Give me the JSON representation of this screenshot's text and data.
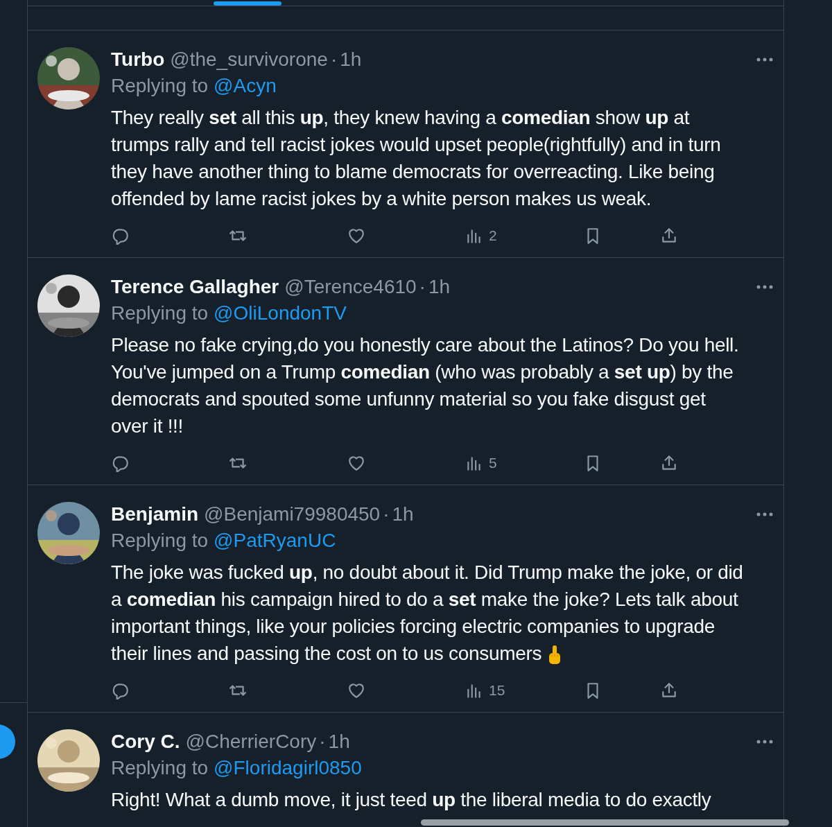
{
  "tweets": [
    {
      "name": "Turbo",
      "handle": "@the_survivorone",
      "separator": "·",
      "time": "1h",
      "replying_label": "Replying to",
      "replying_to": "@Acyn",
      "text": "They really **set** all this **up**, they knew having a **comedian** show **up** at trumps rally and tell racist jokes would upset people(rightfully) and in turn they have another thing to blame democrats for overreacting. Like being offended by lame racist jokes by a white person makes us weak.",
      "views": "2",
      "emoji": false
    },
    {
      "name": "Terence Gallagher",
      "handle": "@Terence4610",
      "separator": "·",
      "time": "1h",
      "replying_label": "Replying to",
      "replying_to": "@OliLondonTV",
      "text": "Please no fake crying,do you honestly care about the Latinos? Do you hell. You've jumped on a Trump **comedian** (who was probably a **set up**) by the democrats and spouted some unfunny material so you fake disgust get over it !!!",
      "views": "5",
      "emoji": false
    },
    {
      "name": "Benjamin",
      "handle": "@Benjami79980450",
      "separator": "·",
      "time": "1h",
      "replying_label": "Replying to",
      "replying_to": "@PatRyanUC",
      "text": "The joke was fucked **up**, no doubt about it. Did Trump make the joke, or did a **comedian** his campaign hired to do a **set** make the joke? Lets talk about important things, like your policies forcing electric companies to upgrade their lines and passing the cost on to us consumers",
      "views": "15",
      "emoji": true
    },
    {
      "name": "Cory C.",
      "handle": "@CherrierCory",
      "separator": "·",
      "time": "1h",
      "replying_label": "Replying to",
      "replying_to": "@Floridagirl0850",
      "text": "Right! What a dumb move, it just teed **up** the liberal media to do exactly",
      "emoji": false
    }
  ]
}
